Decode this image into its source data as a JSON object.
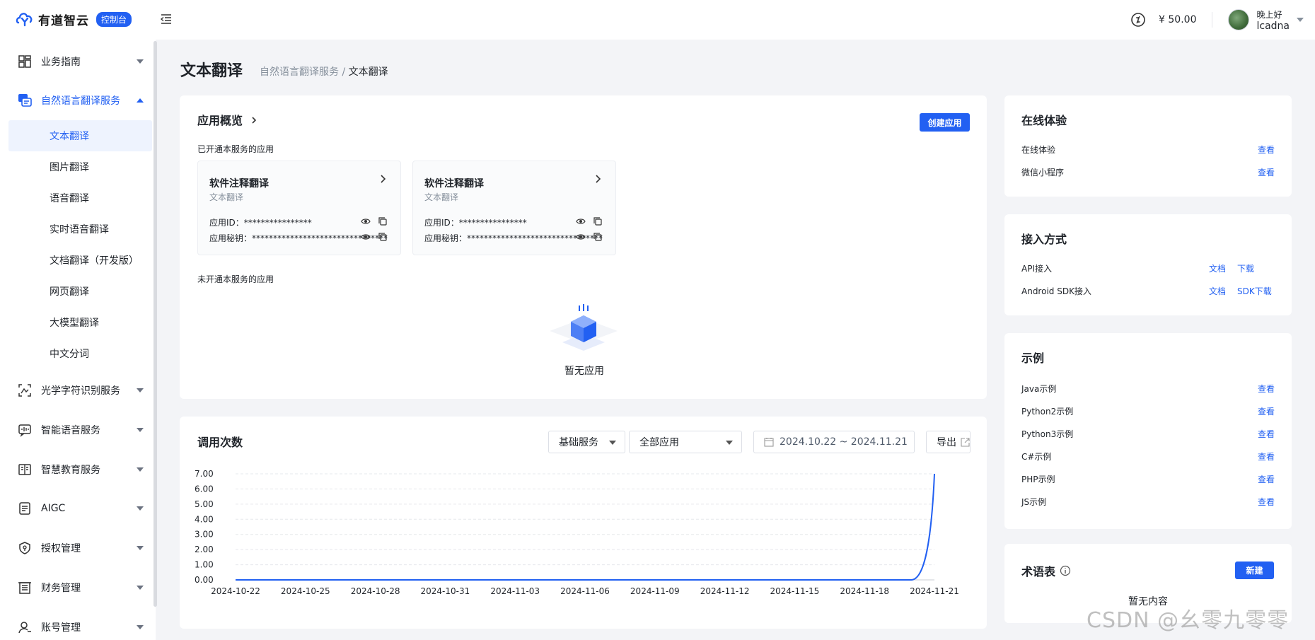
{
  "header": {
    "logo_text": "有道智云",
    "logo_badge": "控制台",
    "balance": "¥ 50.00",
    "greeting": "晚上好",
    "username": "lcadna"
  },
  "sidebar": {
    "items": [
      {
        "label": "业务指南",
        "icon": "grid-icon"
      },
      {
        "label": "自然语言翻译服务",
        "icon": "translate-icon"
      },
      {
        "label": "光学字符识别服务",
        "icon": "ocr-scan-icon"
      },
      {
        "label": "智能语音服务",
        "icon": "voice-icon"
      },
      {
        "label": "智慧教育服务",
        "icon": "education-icon"
      },
      {
        "label": "AIGC",
        "icon": "aigc-icon"
      },
      {
        "label": "授权管理",
        "icon": "shield-icon"
      },
      {
        "label": "财务管理",
        "icon": "finance-icon"
      },
      {
        "label": "账号管理",
        "icon": "user-icon"
      }
    ],
    "subitems": [
      "文本翻译",
      "图片翻译",
      "语音翻译",
      "实时语音翻译",
      "文档翻译（开发版）",
      "网页翻译",
      "大模型翻译",
      "中文分词"
    ]
  },
  "page": {
    "title": "文本翻译",
    "breadcrumb_parent": "自然语言翻译服务",
    "breadcrumb_sep": " / ",
    "breadcrumb_current": "文本翻译"
  },
  "overview": {
    "title": "应用概览",
    "create_btn": "创建应用",
    "enabled_label": "已开通本服务的应用",
    "disabled_label": "未开通本服务的应用",
    "empty_text": "暂无应用",
    "apps": [
      {
        "name": "软件注释翻译",
        "type": "文本翻译",
        "id_label": "应用ID：",
        "id_value": "****************",
        "secret_label": "应用秘钥：",
        "secret_value": "********************************"
      },
      {
        "name": "软件注释翻译",
        "type": "文本翻译",
        "id_label": "应用ID：",
        "id_value": "****************",
        "secret_label": "应用秘钥：",
        "secret_value": "********************************"
      }
    ]
  },
  "usage": {
    "title": "调用次数",
    "service_select": "基础服务",
    "app_select": "全部应用",
    "date_range": "2024.10.22 ~ 2024.11.21",
    "export_label": "导出"
  },
  "chart_data": {
    "type": "line",
    "x": [
      "2024-10-22",
      "2024-10-23",
      "2024-10-24",
      "2024-10-25",
      "2024-10-26",
      "2024-10-27",
      "2024-10-28",
      "2024-10-29",
      "2024-10-30",
      "2024-10-31",
      "2024-11-01",
      "2024-11-02",
      "2024-11-03",
      "2024-11-04",
      "2024-11-05",
      "2024-11-06",
      "2024-11-07",
      "2024-11-08",
      "2024-11-09",
      "2024-11-10",
      "2024-11-11",
      "2024-11-12",
      "2024-11-13",
      "2024-11-14",
      "2024-11-15",
      "2024-11-16",
      "2024-11-17",
      "2024-11-18",
      "2024-11-19",
      "2024-11-20",
      "2024-11-21"
    ],
    "x_tick_labels": [
      "2024-10-22",
      "2024-10-25",
      "2024-10-28",
      "2024-10-31",
      "2024-11-03",
      "2024-11-06",
      "2024-11-09",
      "2024-11-12",
      "2024-11-15",
      "2024-11-18",
      "2024-11-21"
    ],
    "values": [
      0,
      0,
      0,
      0,
      0,
      0,
      0,
      0,
      0,
      0,
      0,
      0,
      0,
      0,
      0,
      0,
      0,
      0,
      0,
      0,
      0,
      0,
      0,
      0,
      0,
      0,
      0,
      0,
      0,
      0,
      7
    ],
    "y_ticks": [
      "0.00",
      "1.00",
      "2.00",
      "3.00",
      "4.00",
      "5.00",
      "6.00",
      "7.00"
    ],
    "ylim": [
      0,
      7
    ],
    "grid": true,
    "color": "#2260f2",
    "title": "",
    "xlabel": "",
    "ylabel": ""
  },
  "online": {
    "title": "在线体验",
    "rows": [
      {
        "label": "在线体验",
        "link": "查看"
      },
      {
        "label": "微信小程序",
        "link": "查看"
      }
    ]
  },
  "access": {
    "title": "接入方式",
    "rows": [
      {
        "label": "API接入",
        "link1": "文档",
        "link2": "下载"
      },
      {
        "label": "Android SDK接入",
        "link1": "文档",
        "link2": "SDK下载"
      }
    ]
  },
  "examples": {
    "title": "示例",
    "rows": [
      {
        "label": "Java示例",
        "link": "查看"
      },
      {
        "label": "Python2示例",
        "link": "查看"
      },
      {
        "label": "Python3示例",
        "link": "查看"
      },
      {
        "label": "C#示例",
        "link": "查看"
      },
      {
        "label": "PHP示例",
        "link": "查看"
      },
      {
        "label": "JS示例",
        "link": "查看"
      }
    ]
  },
  "glossary": {
    "title": "术语表",
    "new_btn": "新建",
    "empty": "暂无内容"
  },
  "watermark": "CSDN @幺零九零零",
  "colors": {
    "accent": "#2260f2",
    "background": "#f3f4f7"
  }
}
